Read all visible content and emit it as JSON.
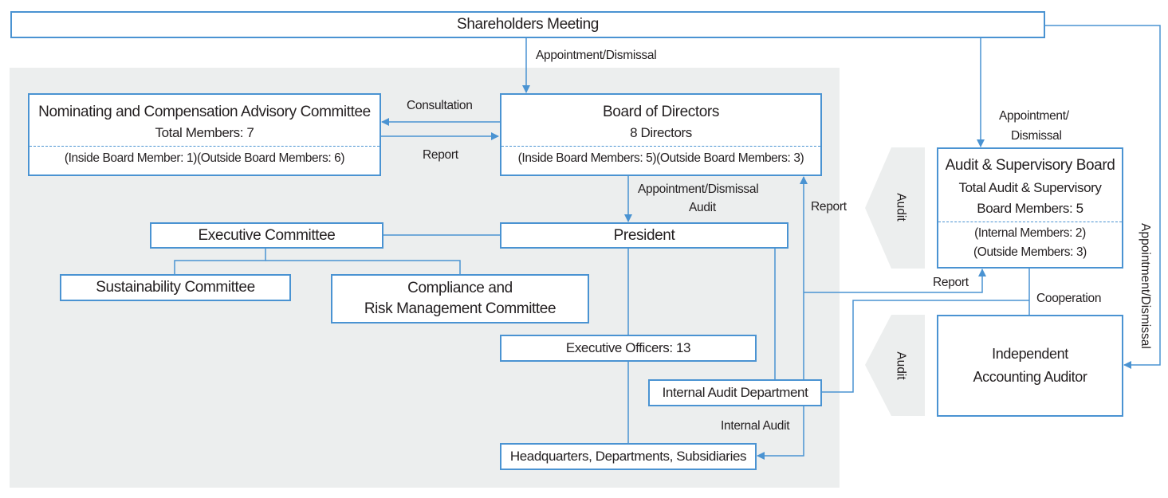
{
  "colors": {
    "line": "#4a93d2",
    "background": "#eceeee"
  },
  "shareholders": "Shareholders Meeting",
  "nominating": {
    "title": "Nominating and Compensation Advisory Committee",
    "total": "Total Members: 7",
    "breakdown": "(Inside Board Member: 1)(Outside Board Members: 6)"
  },
  "board": {
    "title": "Board of Directors",
    "total": "8 Directors",
    "breakdown": "(Inside Board Members: 5)(Outside Board Members: 3)"
  },
  "executive_committee": "Executive Committee",
  "president": "President",
  "sustainability": "Sustainability Committee",
  "compliance": {
    "line1": "Compliance and",
    "line2": "Risk Management Committee"
  },
  "executive_officers": "Executive Officers: 13",
  "internal_audit_dept": "Internal Audit Department",
  "hq": "Headquarters, Departments, Subsidiaries",
  "audit_board": {
    "title": "Audit & Supervisory Board",
    "total1": "Total Audit & Supervisory",
    "total2": "Board Members: 5",
    "internal": "(Internal Members: 2)",
    "outside": "(Outside Members: 3)"
  },
  "auditor": {
    "line1": "Independent",
    "line2": "Accounting Auditor"
  },
  "labels": {
    "appointment_dismissal": "Appointment/Dismissal",
    "appointment": "Appointment/",
    "dismissal": "Dismissal",
    "consultation": "Consultation",
    "report": "Report",
    "audit": "Audit",
    "cooperation": "Cooperation",
    "internal_audit": "Internal Audit"
  }
}
